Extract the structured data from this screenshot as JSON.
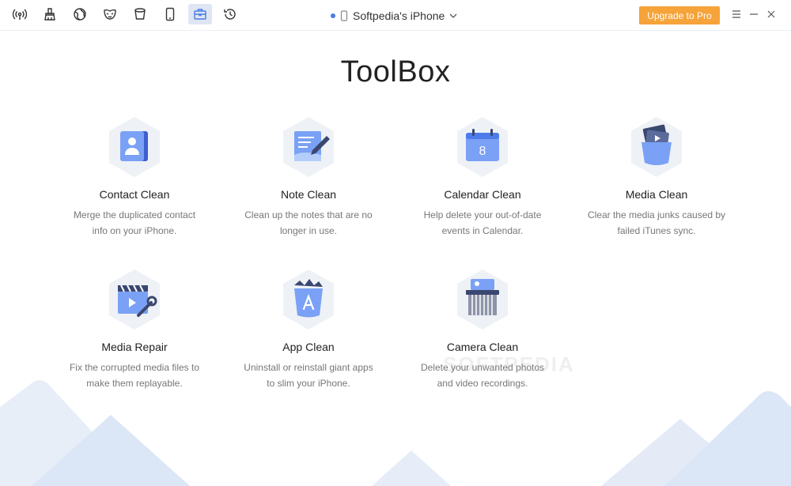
{
  "nav": {
    "icons": [
      "wifi-icon",
      "broom-icon",
      "globe-icon",
      "mask-icon",
      "bucket-icon",
      "phone-icon",
      "toolbox-icon",
      "history-icon"
    ],
    "active": "toolbox-icon"
  },
  "device": {
    "name": "Softpedia's iPhone"
  },
  "header": {
    "upgrade_label": "Upgrade to Pro"
  },
  "page": {
    "title": "ToolBox"
  },
  "tools": [
    {
      "name": "Contact Clean",
      "desc1": "Merge the duplicated contact",
      "desc2": "info on your iPhone."
    },
    {
      "name": "Note Clean",
      "desc1": "Clean up the notes that are no",
      "desc2": "longer in use."
    },
    {
      "name": "Calendar Clean",
      "desc1": "Help delete your out-of-date",
      "desc2": "events in Calendar.",
      "badge": "8"
    },
    {
      "name": "Media Clean",
      "desc1": "Clear the media junks caused by",
      "desc2": "failed iTunes sync."
    },
    {
      "name": "Media Repair",
      "desc1": "Fix the corrupted media files to",
      "desc2": "make them replayable."
    },
    {
      "name": "App Clean",
      "desc1": "Uninstall or reinstall giant apps",
      "desc2": "to slim your iPhone."
    },
    {
      "name": "Camera Clean",
      "desc1": "Delete your unwanted photos",
      "desc2": "and video recordings."
    }
  ],
  "watermark": "SOFTPEDIA",
  "colors": {
    "accent": "#4a7de2",
    "upgrade": "#f6a33a",
    "hex": "#eef1f6"
  }
}
